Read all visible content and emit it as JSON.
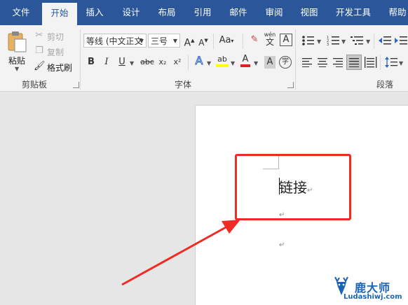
{
  "tabs": [
    "文件",
    "开始",
    "插入",
    "设计",
    "布局",
    "引用",
    "邮件",
    "审阅",
    "视图",
    "开发工具",
    "帮助"
  ],
  "active_tab": "开始",
  "clipboard": {
    "paste_label": "粘贴",
    "cut_label": "剪切",
    "copy_label": "复制",
    "format_painter_label": "格式刷",
    "group_label": "剪贴板"
  },
  "font": {
    "font_name": "等线 (中文正文",
    "font_size": "三号",
    "grow_label": "A",
    "shrink_label": "A",
    "case_label": "Aa",
    "wen_label": "wén",
    "wen_char": "文",
    "bold": "B",
    "italic": "I",
    "underline": "U",
    "strike": "abc",
    "sub": "x₂",
    "sup": "x²",
    "effect": "A",
    "highlight": "ab",
    "color": "A",
    "shade": "A",
    "enclose": "字",
    "group_label": "字体"
  },
  "paragraph": {
    "group_label": "段落"
  },
  "colors": {
    "ribbon_blue": "#2b579a",
    "highlight_red": "#ee2b24",
    "text_highlight_yellow": "#ffff00",
    "font_color_red": "#e02020",
    "logo_blue": "#1a63b5"
  },
  "document": {
    "text": "链接",
    "para_mark": "↵"
  },
  "logo": {
    "cn": "鹿大师",
    "en": "Ludashiwj.com"
  }
}
